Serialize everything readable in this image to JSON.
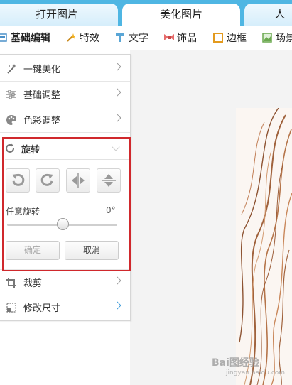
{
  "tabs": [
    {
      "label": "打开图片"
    },
    {
      "label": "美化图片",
      "active": true
    },
    {
      "label": "人"
    }
  ],
  "toolbar": [
    {
      "label": "基础编辑",
      "icon": "basic-edit-icon",
      "active": true
    },
    {
      "label": "特效",
      "icon": "magic-wand-icon"
    },
    {
      "label": "文字",
      "icon": "text-t-icon"
    },
    {
      "label": "饰品",
      "icon": "bow-icon"
    },
    {
      "label": "边框",
      "icon": "frame-icon"
    },
    {
      "label": "场景",
      "icon": "scene-icon"
    }
  ],
  "panel": {
    "items_top": [
      {
        "label": "一键美化",
        "icon": "wand-sparkle-icon"
      },
      {
        "label": "基础调整",
        "icon": "sliders-icon"
      },
      {
        "label": "色彩调整",
        "icon": "palette-icon"
      }
    ],
    "rotate": {
      "title": "旋转",
      "any_label": "任意旋转",
      "angle": "0°",
      "slider_value_fraction": 0.5,
      "confirm": "确定",
      "cancel": "取消"
    },
    "items_bottom": [
      {
        "label": "裁剪",
        "icon": "crop-icon"
      },
      {
        "label": "修改尺寸",
        "icon": "resize-icon"
      }
    ]
  },
  "watermark": {
    "text": "Bai图经验",
    "sub": "jingyan.baidu.com"
  },
  "colors": {
    "tabbar": "#4fb6e3",
    "highlight": "#d0282c",
    "accent": "#3a9ad9"
  }
}
